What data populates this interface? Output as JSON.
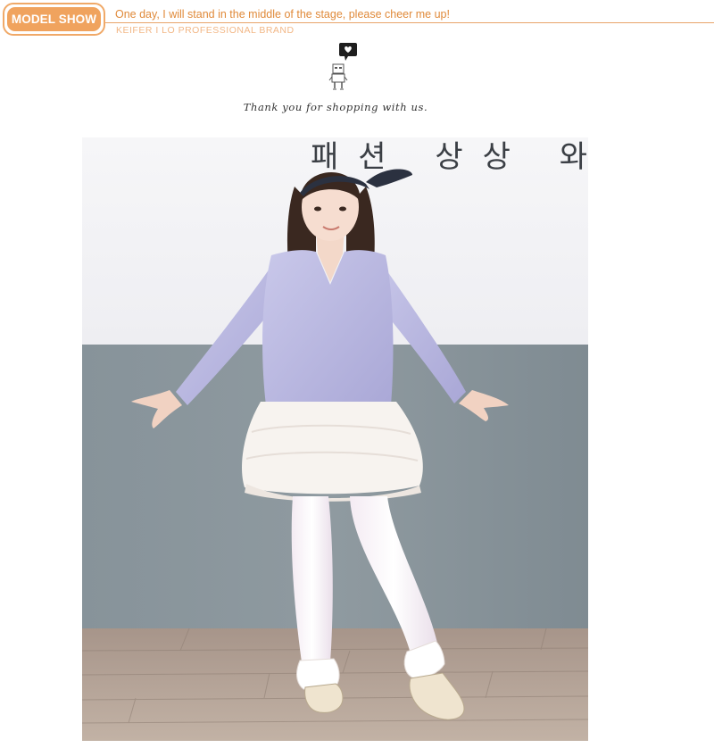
{
  "header": {
    "badge_label": "MODEL SHOW",
    "tagline": "One day, I will stand in the middle of the stage, please cheer me up!",
    "brand": "KEIFER I LO PROFESSIONAL BRAND"
  },
  "thanks": {
    "icon": "heart-speech-robot-icon",
    "text": "Thank you for shopping with us."
  },
  "photo": {
    "korean_text": "패션 상상 와"
  },
  "colors": {
    "accent": "#f0a35e",
    "accent_text": "#e08a3a",
    "brand_text": "#f2b786"
  }
}
